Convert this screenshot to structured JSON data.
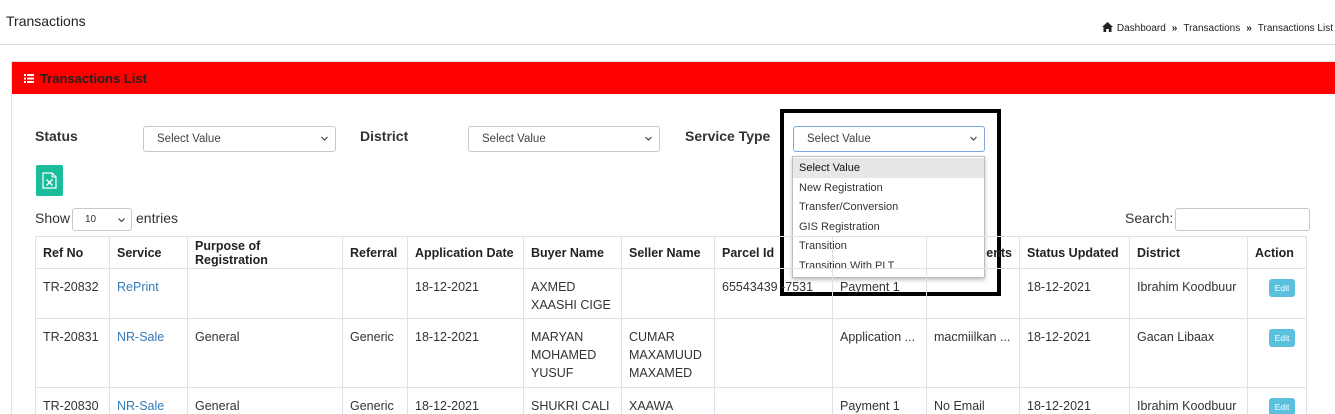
{
  "header": {
    "page_title": "Transactions",
    "breadcrumb": [
      "Dashboard",
      "Transactions",
      "Transactions List"
    ],
    "separator": "»"
  },
  "panel": {
    "title": "Transactions List"
  },
  "filters": {
    "status_label": "Status",
    "status_value": "Select Value",
    "district_label": "District",
    "district_value": "Select Value",
    "service_type_label": "Service Type",
    "service_type_value": "Select Value",
    "service_type_options": [
      "Select Value",
      "New Registration",
      "Transfer/Conversion",
      "GIS Registration",
      "Transition",
      "Transition With PLT"
    ]
  },
  "table_controls": {
    "show_label": "Show",
    "entries_value": "10",
    "entries_label": "entries",
    "search_label": "Search:"
  },
  "table": {
    "columns": [
      "Ref No",
      "Service",
      "Purpose of Registration",
      "Referral",
      "Application Date",
      "Buyer Name",
      "Seller Name",
      "Parcel Id",
      "",
      "ents",
      "Status Updated",
      "District",
      "Action"
    ],
    "rows": [
      {
        "ref": "TR-20832",
        "service": "RePrint",
        "purpose": "",
        "referral": "",
        "app_date": "18-12-2021",
        "buyer": "AXMED XAASHI CIGE",
        "seller": "",
        "parcel": "65543439 -7531",
        "status": "Payment 1",
        "agent": "",
        "updated": "18-12-2021",
        "district": "Ibrahim Koodbuur",
        "action": "Edit"
      },
      {
        "ref": "TR-20831",
        "service": "NR-Sale",
        "purpose": "General",
        "referral": "Generic",
        "app_date": "18-12-2021",
        "buyer": "MARYAN MOHAMED YUSUF",
        "seller": "CUMAR MAXAMUUD MAXAMED",
        "parcel": "",
        "status": "Application ...",
        "agent": "macmiilkan ...",
        "updated": "18-12-2021",
        "district": "Gacan Libaax",
        "action": "Edit"
      },
      {
        "ref": "TR-20830",
        "service": "NR-Sale",
        "purpose": "General",
        "referral": "Generic",
        "app_date": "18-12-2021",
        "buyer": "SHUKRI CALI",
        "seller": "XAAWA",
        "parcel": "",
        "status": "Payment 1",
        "agent": "No Email",
        "updated": "18-12-2021",
        "district": "Ibrahim Koodbuur",
        "action": "Edit"
      }
    ]
  },
  "colors": {
    "panel_header": "#ff0000",
    "excel_button": "#1abc9c",
    "edit_button": "#5bc0de",
    "link": "#337ab7"
  },
  "icons": {
    "home": "home-icon",
    "list": "list-icon",
    "excel": "excel-icon",
    "chevron": "chevron-down-icon"
  }
}
